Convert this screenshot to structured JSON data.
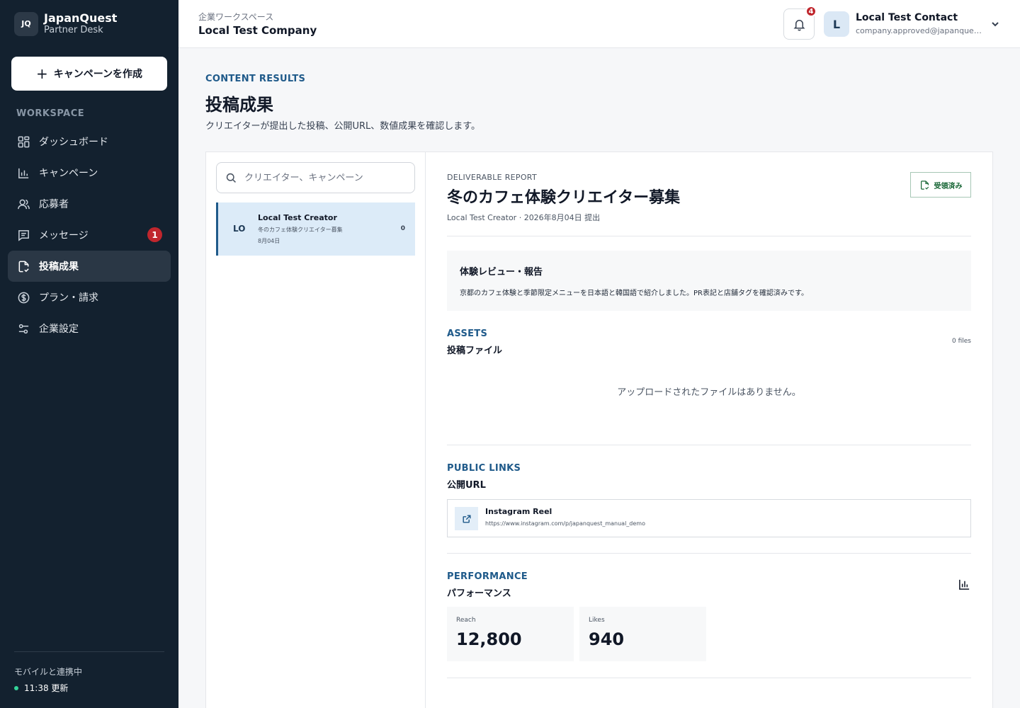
{
  "brand": {
    "logo": "JQ",
    "name": "JapanQuest",
    "subtitle": "Partner Desk"
  },
  "sidebar": {
    "create_label": "キャンペーンを作成",
    "section_label": "WORKSPACE",
    "items": [
      {
        "label": "ダッシュボード",
        "icon": "dashboard-icon"
      },
      {
        "label": "キャンペーン",
        "icon": "bar-chart-icon"
      },
      {
        "label": "応募者",
        "icon": "users-icon"
      },
      {
        "label": "メッセージ",
        "icon": "message-icon",
        "badge": "1"
      },
      {
        "label": "投稿成果",
        "icon": "document-check-icon",
        "active": true
      },
      {
        "label": "プラン・請求",
        "icon": "dollar-icon"
      },
      {
        "label": "企業設定",
        "icon": "settings-sliders-icon"
      }
    ],
    "sync_label": "モバイルと連携中",
    "sync_time": "11:38 更新",
    "sync_status_color": "#34d399"
  },
  "header": {
    "workspace_caption": "企業ワークスペース",
    "company_name": "Local Test Company",
    "notifications_count": "4",
    "user_initial": "L",
    "user_name": "Local Test Contact",
    "user_email": "company.approved@japanquest.local"
  },
  "page": {
    "eyebrow": "CONTENT RESULTS",
    "title": "投稿成果",
    "description": "クリエイターが提出した投稿、公開URL、数値成果を確認します。"
  },
  "list": {
    "search_placeholder": "クリエイター、キャンペーン",
    "items": [
      {
        "initials": "LO",
        "name": "Local Test Creator",
        "campaign": "冬のカフェ体験クリエイター募集",
        "date": "8月04日",
        "count": "0",
        "selected": true
      }
    ]
  },
  "report": {
    "eyebrow": "DELIVERABLE REPORT",
    "title": "冬のカフェ体験クリエイター募集",
    "meta": "Local Test Creator · 2026年8月04日 提出",
    "status_label": "受領済み",
    "review_title": "体験レビュー・報告",
    "review_text": "京都のカフェ体験と季節限定メニューを日本語と韓国語で紹介しました。PR表記と店舗タグを確認済みです。",
    "assets": {
      "eyebrow": "ASSETS",
      "title": "投稿ファイル",
      "count": "0 files",
      "empty": "アップロードされたファイルはありません。"
    },
    "links": {
      "eyebrow": "PUBLIC LINKS",
      "title": "公開URL",
      "items": [
        {
          "title": "Instagram Reel",
          "url": "https://www.instagram.com/p/japanquest_manual_demo"
        }
      ]
    },
    "performance": {
      "eyebrow": "PERFORMANCE",
      "title": "パフォーマンス",
      "metrics": [
        {
          "label": "Reach",
          "value": "12,800"
        },
        {
          "label": "Likes",
          "value": "940"
        }
      ]
    }
  },
  "colors": {
    "sidebar_bg": "#13212f",
    "accent": "#1f5a8a",
    "badge": "#c0262d",
    "success": "#166534"
  }
}
